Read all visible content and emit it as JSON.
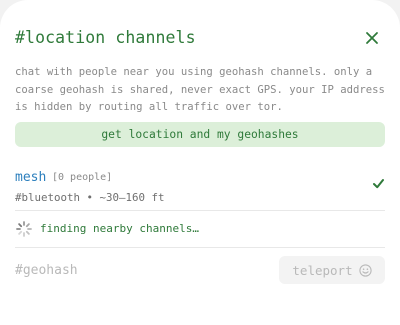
{
  "header": {
    "title": "#location channels",
    "close_icon": "close-icon"
  },
  "description": "chat with people near you using geohash channels. only a coarse geohash is shared, never exact GPS. your IP address is hidden by routing all traffic over tor.",
  "get_location_button": "get location and my geohashes",
  "mesh_channel": {
    "name": "mesh",
    "count": "[0 people]",
    "subtitle": "#bluetooth • ~30–160 ft",
    "selected": true
  },
  "status": {
    "text": "finding nearby channels…",
    "icon": "spinner-icon"
  },
  "geohash_input": {
    "placeholder": "#geohash",
    "value": ""
  },
  "teleport_button": {
    "label": "teleport",
    "icon": "smiley-icon"
  },
  "colors": {
    "accent_green": "#2f7a3a",
    "button_green_bg": "#dcefd9",
    "mesh_blue": "#2c7fbd",
    "muted_text": "#8a8a8a"
  }
}
